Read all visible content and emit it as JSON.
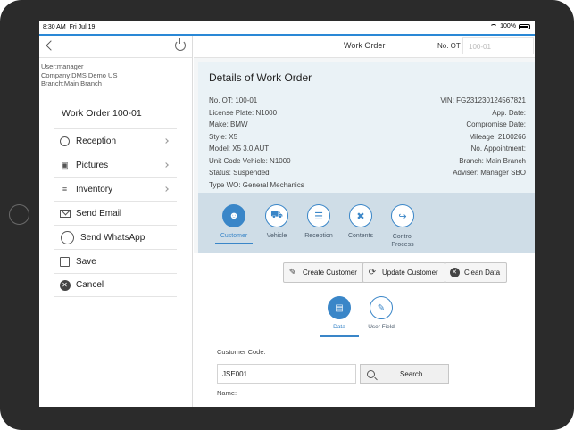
{
  "status_bar": {
    "time": "8:30 AM",
    "date": "Fri Jul 19",
    "battery": "100%"
  },
  "sidebar": {
    "user": "User:manager",
    "company": "Company:DMS Demo US",
    "branch": "Branch:Main Branch",
    "work_order_title": "Work Order 100-01",
    "items": [
      {
        "label": "Reception",
        "icon": "person-icon",
        "chevron": true
      },
      {
        "label": "Pictures",
        "icon": "camera-icon",
        "chevron": true
      },
      {
        "label": "Inventory",
        "icon": "checklist-icon",
        "chevron": true
      },
      {
        "label": "Send Email",
        "icon": "mail-icon",
        "chevron": false
      },
      {
        "label": "Send WhatsApp",
        "icon": "whatsapp-icon",
        "chevron": false
      },
      {
        "label": "Save",
        "icon": "save-icon",
        "chevron": false
      },
      {
        "label": "Cancel",
        "icon": "cancel-icon",
        "chevron": false
      }
    ]
  },
  "header": {
    "title": "Work Order",
    "no_ot_label": "No. OT",
    "no_ot_value": "100-01"
  },
  "details": {
    "heading": "Details of Work Order",
    "left": [
      "No. OT: 100-01",
      "License Plate: N1000",
      "Make: BMW",
      "Style: X5",
      "Model: X5 3.0 AUT",
      "Unit Code Vehicle: N1000",
      "Status: Suspended",
      "Type WO: General Mechanics"
    ],
    "right": [
      "VIN: FG231230124567821",
      "App. Date:",
      "Compromise Date:",
      "Mileage: 2100266",
      "No. Appointment:",
      "Branch: Main Branch",
      "Adviser: Manager SBO"
    ]
  },
  "tabs": [
    {
      "label": "Customer",
      "icon": "customer-icon",
      "active": true
    },
    {
      "label": "Vehicle",
      "icon": "car-icon",
      "active": false
    },
    {
      "label": "Reception",
      "icon": "clipboard-icon",
      "active": false
    },
    {
      "label": "Contents",
      "icon": "tools-icon",
      "active": false
    },
    {
      "label": "Control Process",
      "icon": "control-icon",
      "active": false
    }
  ],
  "actions": {
    "create_customer": "Create Customer",
    "update_customer": "Update Customer",
    "clean_data": "Clean Data"
  },
  "subtabs": [
    {
      "label": "Data",
      "icon": "document-icon",
      "active": true
    },
    {
      "label": "User Field",
      "icon": "user-field-icon",
      "active": false
    }
  ],
  "form": {
    "customer_code_label": "Customer Code:",
    "customer_code_value": "JSE001",
    "search_label": "Search",
    "name_label": "Name:"
  },
  "colors": {
    "accent": "#3a86c8",
    "details_bg": "#eaf2f6",
    "tabs_bg": "#cfdde7"
  }
}
